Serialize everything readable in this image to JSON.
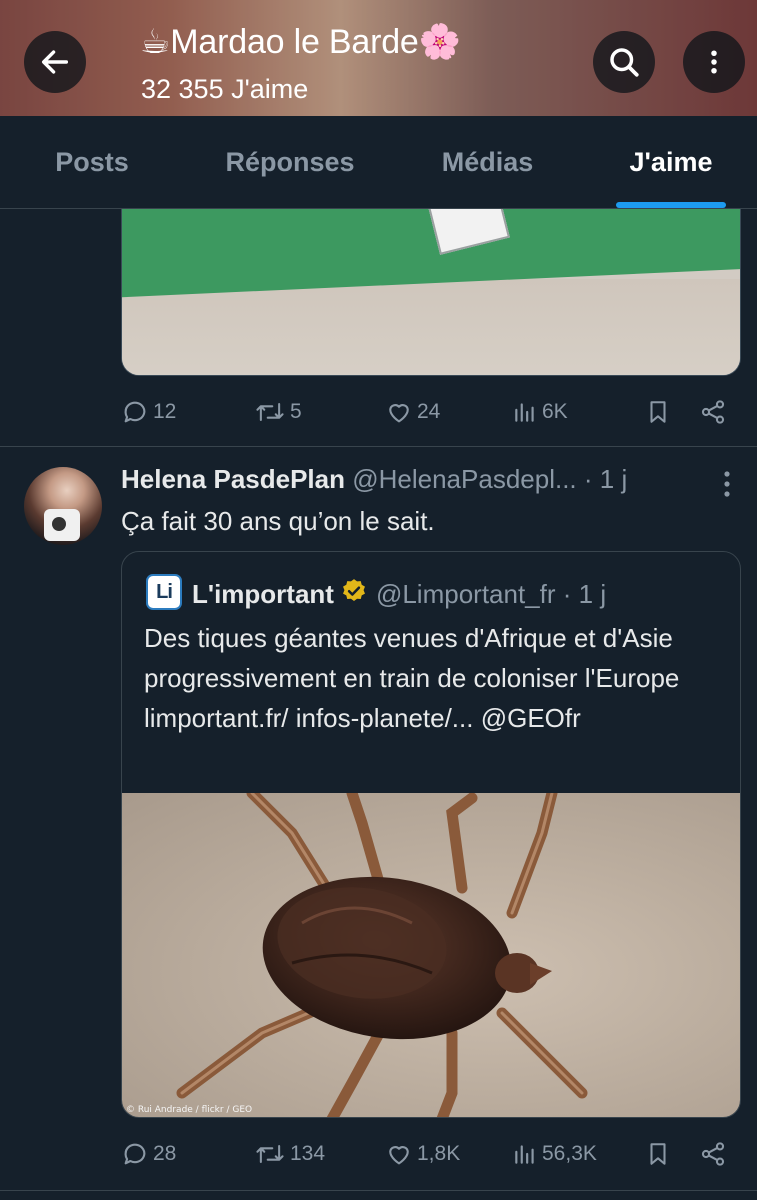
{
  "header": {
    "title": "☕Mardao le Barde🌸",
    "subtitle": "32 355 J'aime"
  },
  "tabs": [
    {
      "label": "Posts",
      "active": false
    },
    {
      "label": "Réponses",
      "active": false
    },
    {
      "label": "Médias",
      "active": false
    },
    {
      "label": "J'aime",
      "active": true
    }
  ],
  "tweet1": {
    "replies": "12",
    "retweets": "5",
    "likes": "24",
    "views": "6K"
  },
  "tweet2": {
    "name": "Helena PasdePlan",
    "handle": "@HelenaPasdepl...",
    "time": "· 1 j",
    "text": "Ça fait 30 ans qu’on le sait.",
    "quote": {
      "logo": "Li",
      "name": "L'important",
      "handle": "@Limportant_fr · 1 j",
      "text": "Des tiques géantes venues d'Afrique et d'Asie progressivement en train de coloniser l'Europe limportant.fr/ infos-planete/... @GEOfr",
      "image_credit": "© Rui Andrade / flickr / GEO"
    },
    "replies": "28",
    "retweets": "134",
    "likes": "1,8K",
    "views": "56,3K"
  },
  "colors": {
    "background": "#15202b",
    "accent": "#1d9bf0",
    "muted_text": "#8b98a5",
    "divider": "#38444d",
    "verified_gold": "#e2b719"
  },
  "icons": [
    "back-arrow-icon",
    "search-icon",
    "more-vertical-icon",
    "reply-icon",
    "retweet-icon",
    "like-icon",
    "views-icon",
    "bookmark-icon",
    "share-icon",
    "verified-badge-icon"
  ]
}
